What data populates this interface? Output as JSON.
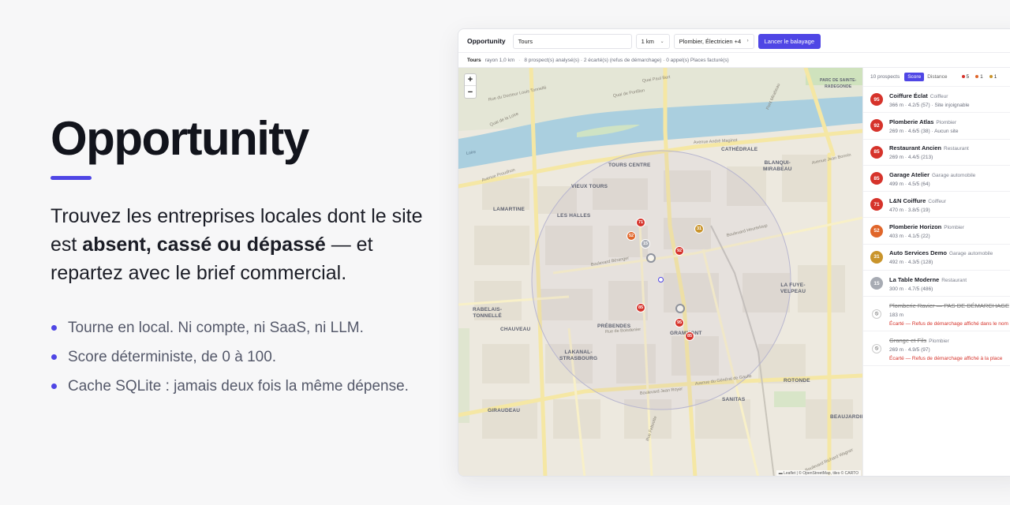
{
  "hero": {
    "title": "Opportunity",
    "tagline_start": "Trouvez les entreprises locales dont le site est ",
    "tagline_bold": "absent, cassé ou dépassé",
    "tagline_end": " — et repartez avec le brief commercial.",
    "bullets": [
      "Tourne en local. Ni compte, ni SaaS, ni LLM.",
      "Score déterministe, de 0 à 100.",
      "Cache SQLite : jamais deux fois la même dépense."
    ]
  },
  "app": {
    "brand": "Opportunity",
    "city_value": "Tours",
    "radius_value": "1 km",
    "categories_value": "Plombier, Électricien +4",
    "scan_button": "Lancer le balayage",
    "status": {
      "city": "Tours",
      "radius": "rayon 1,0 km",
      "summary": "8 prospect(s) analysé(s) · 2 écarté(s) (refus de démarchage) · 0 appel(s) Places facturé(s)"
    },
    "map": {
      "zoom_in": "+",
      "zoom_out": "−",
      "attribution": "▬ Leaflet | © OpenStreetMap, tiles © CARTO",
      "places": {
        "tours_centre": "TOURS CENTRE",
        "vieux_tours": "VIEUX TOURS",
        "lamartine": "LAMARTINE",
        "les_halles": "LES HALLES",
        "cathedrale": "CATHÉDRALE",
        "blanqui": "BLANQUI-\nMIRABEAU",
        "la_fuye": "LA FUYE-\nVELPEAU",
        "rabelais": "RABELAIS-\nTONNELLÉ",
        "chauveau": "CHAUVEAU",
        "prebendes": "PRÉBENDES",
        "grammont": "GRAMMONT",
        "lakanal": "LAKANAL-\nSTRASBOURG",
        "rotonde": "ROTONDE",
        "sanitas": "SANITAS",
        "giraudeau": "GIRAUDEAU",
        "beaujardin": "BEAUJARDIN",
        "parc": "PARC DE SAINTE-\nRADEGONDE"
      },
      "streets": {
        "quai_paul_bert": "Quai Paul Bert",
        "quai_portillon": "Quai de Portillon",
        "quai_loire": "Quai de la Loire",
        "rue_docteur": "Rue du Docteur Louis Tonnellé",
        "loire": "Loire",
        "avenue_proudhon": "Avenue Proudhon",
        "boulevard_beranger": "Boulevard Béranger",
        "boulevard_heurteloup": "Boulevard Heurteloup",
        "avenue_gramont": "Avenue Grammont",
        "avenue_maginot": "Avenue André Maginot",
        "boulevard_jean_royer": "Boulevard Jean Royer",
        "avenue_gaulle": "Avenue du Général de Gaulle",
        "avenue_jean_bonnin": "Avenue Jean Bonnin",
        "rue_boisdenier": "Rue de Boisdenier",
        "pont_mirabeau": "Pont Mirabeau",
        "boulevard_wagner": "Boulevard Richard Wagner",
        "rue_febvotte": "Rue Febvotte"
      },
      "markers": [
        {
          "score": "71",
          "tone": "red"
        },
        {
          "score": "52",
          "tone": "orange"
        },
        {
          "score": "15",
          "tone": "grey"
        },
        {
          "score": "31",
          "tone": "gold"
        },
        {
          "score": "92",
          "tone": "red"
        },
        {
          "score": "85",
          "tone": "red"
        },
        {
          "score": "95",
          "tone": "red"
        },
        {
          "score": "85",
          "tone": "red"
        }
      ]
    },
    "panel": {
      "count": "10 prospects",
      "sort_score": "Score",
      "sort_distance": "Distance",
      "legend": [
        {
          "count": "5",
          "color": "#d6332b"
        },
        {
          "count": "1",
          "color": "#e0662a"
        },
        {
          "count": "1",
          "color": "#c9942b"
        }
      ],
      "items": [
        {
          "score": "95",
          "tone": "red",
          "name": "Coiffure Éclat",
          "category": "Coiffeur",
          "meta": "366 m  · 4.2/5 (57)  · Site injoignable"
        },
        {
          "score": "92",
          "tone": "red",
          "name": "Plomberie Atlas",
          "category": "Plombier",
          "meta": "269 m  · 4.6/5 (38)  · Aucun site"
        },
        {
          "score": "85",
          "tone": "red",
          "name": "Restaurant Ancien",
          "category": "Restaurant",
          "meta": "269 m  · 4.4/5 (213)"
        },
        {
          "score": "85",
          "tone": "red",
          "name": "Garage Atelier",
          "category": "Garage automobile",
          "meta": "499 m  · 4.5/5 (64)"
        },
        {
          "score": "71",
          "tone": "red",
          "name": "L&N Coiffure",
          "category": "Coiffeur",
          "meta": "470 m  · 3.8/5 (19)"
        },
        {
          "score": "52",
          "tone": "orange",
          "name": "Plomberie Horizon",
          "category": "Plombier",
          "meta": "403 m  · 4.1/5 (22)"
        },
        {
          "score": "31",
          "tone": "gold",
          "name": "Auto Services Demo",
          "category": "Garage automobile",
          "meta": "492 m  · 4.3/5 (128)"
        },
        {
          "score": "15",
          "tone": "grey",
          "name": "La Table Moderne",
          "category": "Restaurant",
          "meta": "300 m  · 4.7/5 (486)"
        }
      ],
      "excluded": [
        {
          "icon": "⦸",
          "name": "Plomberie Ravier — PAS DE DÉMARCHAGE",
          "category": "",
          "meta": "183 m",
          "warning": "Écarté — Refus de démarchage affiché dans le nom"
        },
        {
          "icon": "⦸",
          "name": "Grange et Fils",
          "category": "Plombier",
          "meta": "269 m  · 4.9/5 (97)",
          "warning": "Écarté — Refus de démarchage affiché à la place"
        }
      ]
    }
  }
}
